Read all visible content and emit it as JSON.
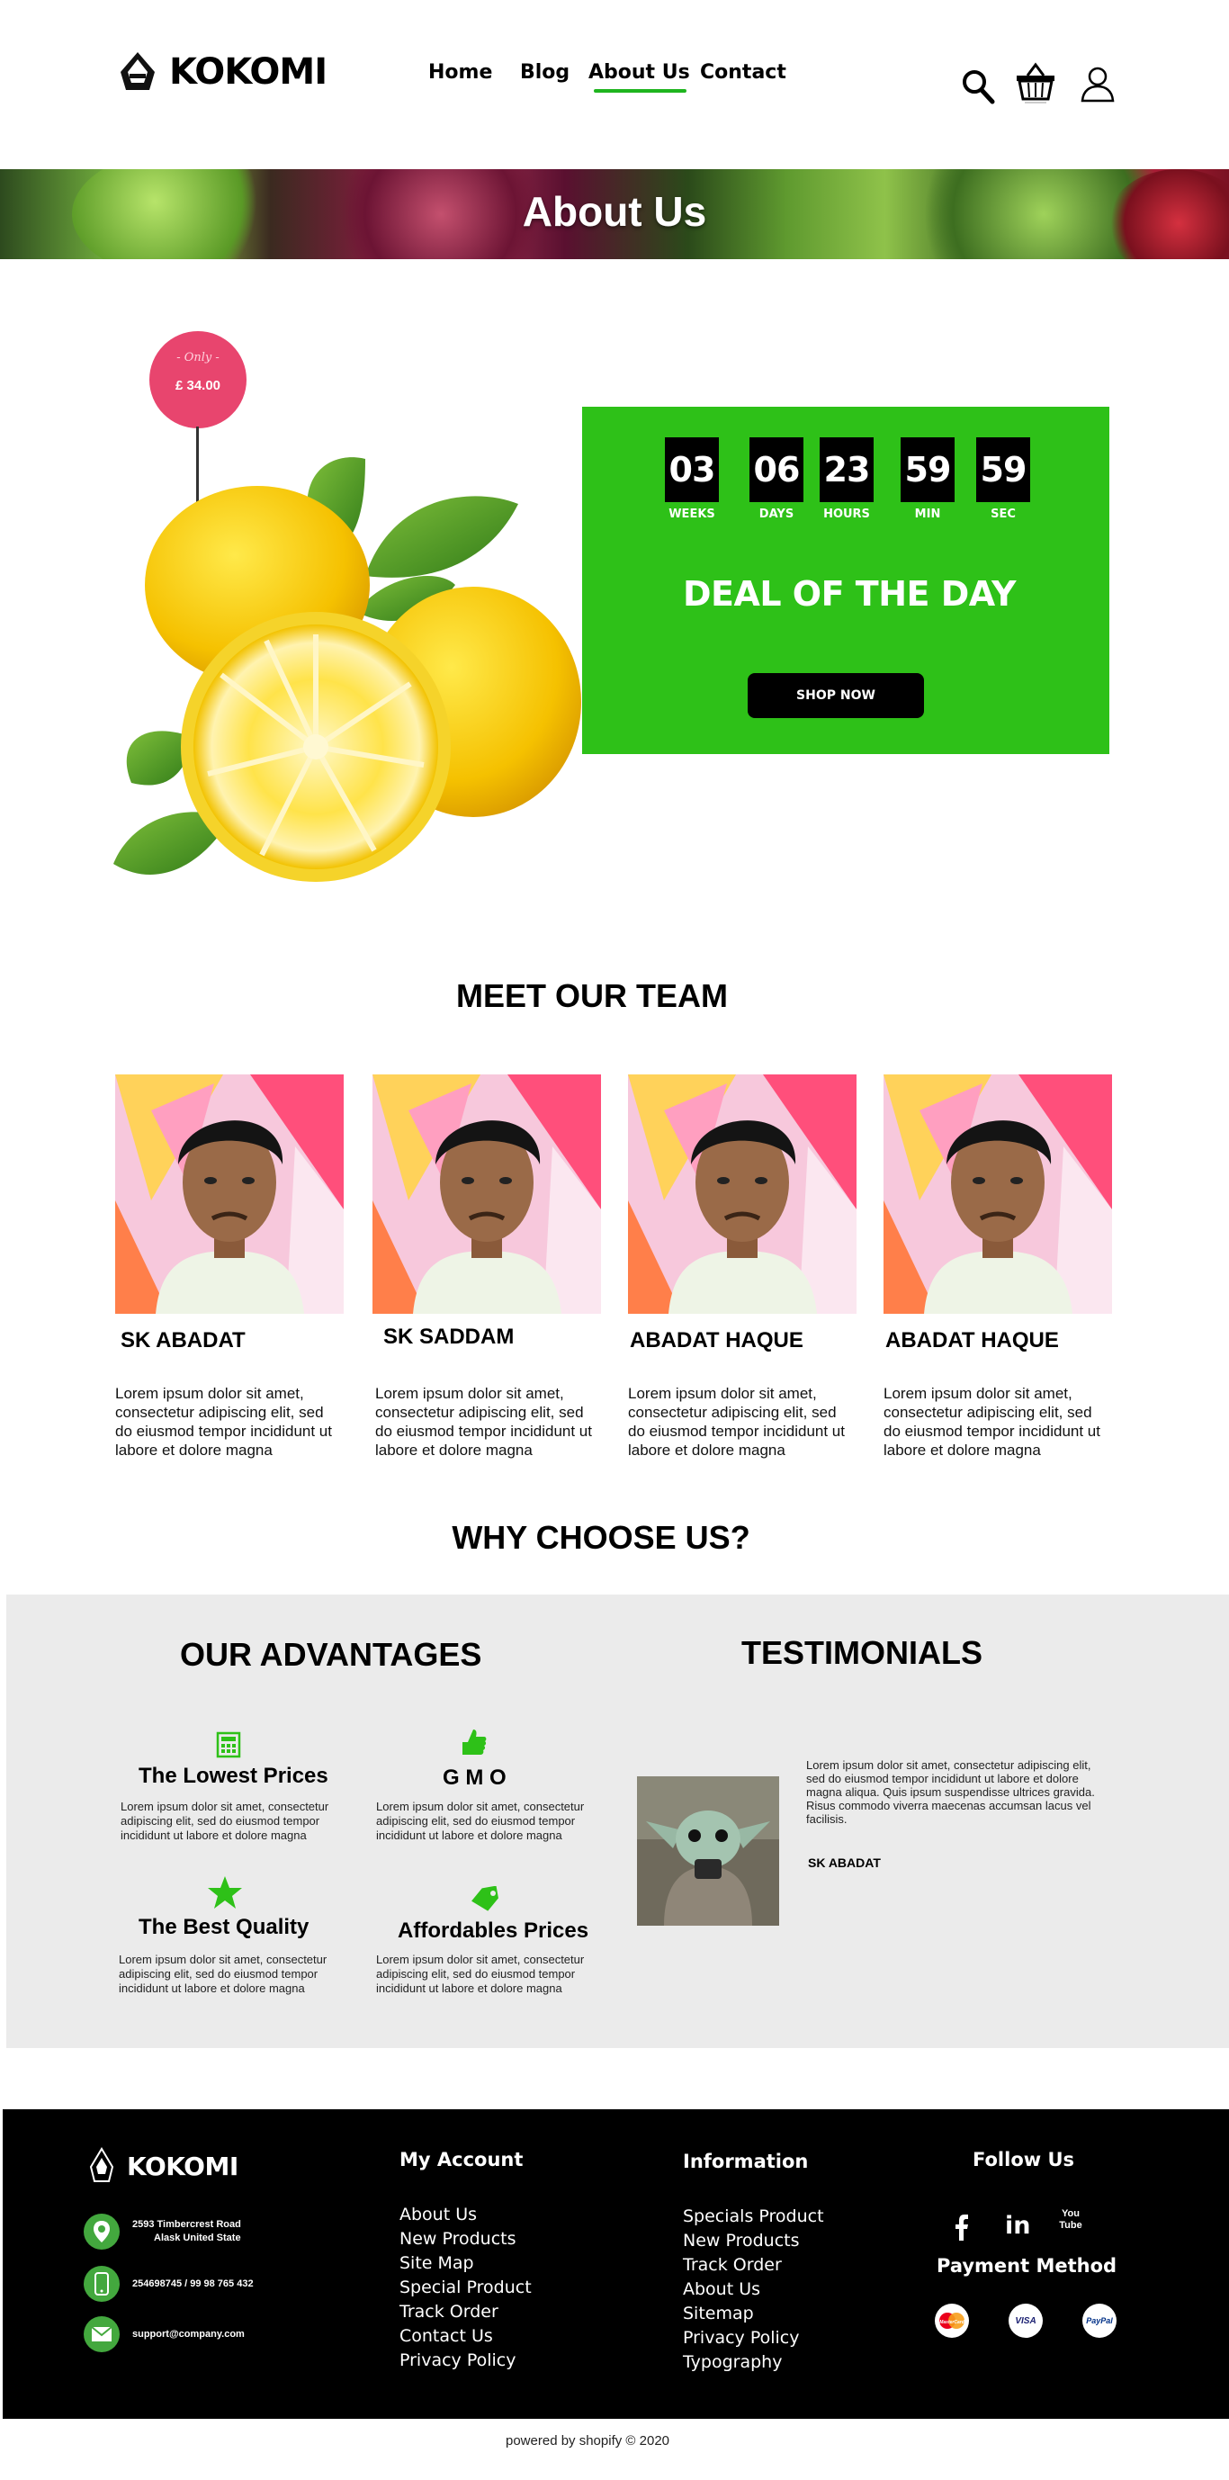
{
  "brand": {
    "name": "KOKOMI"
  },
  "nav": {
    "home": "Home",
    "blog": "Blog",
    "about": "About Us",
    "contact": "Contact"
  },
  "icons": {
    "search": "search-icon",
    "cart": "basket-icon",
    "user": "user-icon"
  },
  "banner": {
    "title": "About Us"
  },
  "deal": {
    "tag_only": "- Only -",
    "tag_price": "£ 34.00",
    "countdown": [
      {
        "value": "03",
        "label": "WEEKS"
      },
      {
        "value": "06",
        "label": "DAYS"
      },
      {
        "value": "23",
        "label": "HOURS"
      },
      {
        "value": "59",
        "label": "MIN"
      },
      {
        "value": "59",
        "label": "SEC"
      }
    ],
    "title": "DEAL OF THE DAY",
    "button": "SHOP NOW",
    "accent": "#2ec118",
    "tag_color": "#e8456e"
  },
  "team": {
    "title": "MEET OUR TEAM",
    "members": [
      {
        "name": "SK ABADAT",
        "desc": "Lorem ipsum dolor sit amet, consectetur adipiscing elit, sed do eiusmod tempor incididunt ut labore et dolore magna"
      },
      {
        "name": "SK SADDAM",
        "desc": "Lorem ipsum dolor sit amet, consectetur adipiscing elit, sed do eiusmod tempor incididunt ut labore et dolore magna"
      },
      {
        "name": "ABADAT HAQUE",
        "desc": "Lorem ipsum dolor sit amet, consectetur adipiscing elit, sed do eiusmod tempor incididunt ut labore et dolore magna"
      },
      {
        "name": "ABADAT HAQUE",
        "desc": "Lorem ipsum dolor sit amet, consectetur adipiscing elit, sed do eiusmod tempor incididunt ut labore et dolore magna"
      }
    ]
  },
  "why": {
    "title": "WHY CHOOSE US?"
  },
  "advantages": {
    "title": "OUR ADVANTAGES",
    "items": [
      {
        "title": "The Lowest Prices",
        "icon": "calculator-icon",
        "desc": "Lorem ipsum dolor sit amet, consectetur adipiscing elit, sed do eiusmod tempor incididunt ut labore et dolore magna"
      },
      {
        "title": "G M O",
        "icon": "thumbs-up-icon",
        "desc": "Lorem ipsum dolor sit amet, consectetur adipiscing elit, sed do eiusmod tempor incididunt ut labore et dolore magna"
      },
      {
        "title": "The Best Quality",
        "icon": "star-icon",
        "desc": "Lorem ipsum dolor sit amet, consectetur adipiscing elit, sed do eiusmod tempor incididunt ut labore et dolore magna"
      },
      {
        "title": "Affordables Prices",
        "icon": "price-tag-icon",
        "desc": "Lorem ipsum dolor sit amet, consectetur adipiscing elit, sed do eiusmod tempor incididunt ut labore et dolore magna"
      }
    ]
  },
  "testimonials": {
    "title": "TESTIMONIALS",
    "text": "Lorem ipsum dolor sit amet, consectetur adipiscing elit, sed do eiusmod tempor incididunt ut labore et dolore magna aliqua. Quis ipsum suspendisse ultrices gravida. Risus commodo viverra maecenas accumsan lacus vel facilisis.",
    "name": "SK ABADAT"
  },
  "footer": {
    "brand": "KOKOMI",
    "address_line1": "2593 Timbercrest Road",
    "address_line2": "Alask United State",
    "phone": "254698745 / 99 98 765 432",
    "email": "support@company.com",
    "my_account": {
      "title": "My Account",
      "links": [
        "About Us",
        "New Products",
        "Site Map",
        "Special Product",
        "Track Order",
        "Contact Us",
        "Privacy Policy"
      ]
    },
    "information": {
      "title": "Information",
      "links": [
        "Specials Product",
        "New Products",
        "Track Order",
        "About Us",
        "Sitemap",
        "Privacy Policy",
        "Typography"
      ]
    },
    "follow": {
      "title": "Follow Us",
      "icons": [
        "facebook-icon",
        "linkedin-icon",
        "youtube-icon"
      ],
      "youtube_label": "You Tube"
    },
    "payment": {
      "title": "Payment Method",
      "cards": [
        "MasterCard",
        "VISA",
        "PayPal"
      ]
    }
  },
  "powered": "powered by shopify  ©  2020"
}
